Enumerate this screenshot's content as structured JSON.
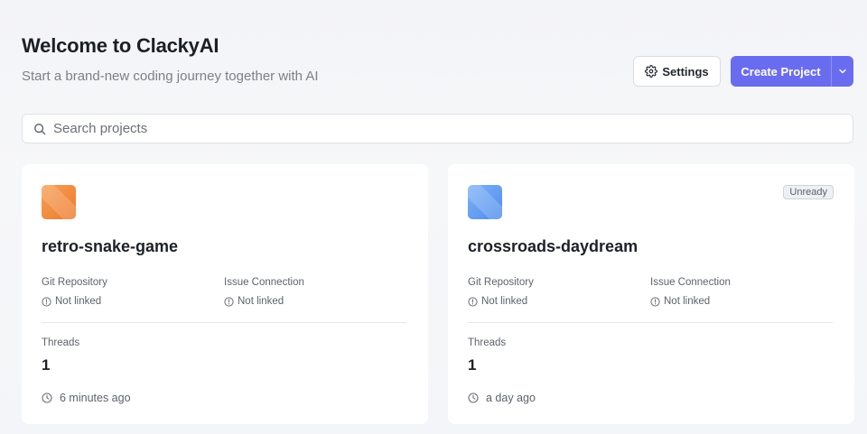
{
  "header": {
    "title": "Welcome to ClackyAI",
    "subtitle": "Start a brand-new coding journey together with AI",
    "settings_label": "Settings",
    "create_label": "Create Project"
  },
  "search": {
    "placeholder": "Search projects",
    "value": ""
  },
  "colors": {
    "accent": "#6a6cf0",
    "orange_icon": "#f28a3c",
    "blue_icon": "#5f9cf2"
  },
  "projects": [
    {
      "name": "retro-snake-game",
      "icon": "orange-project-icon",
      "badge": "",
      "git_label": "Git Repository",
      "git_value": "Not linked",
      "issue_label": "Issue Connection",
      "issue_value": "Not linked",
      "threads_label": "Threads",
      "threads_count": "1",
      "updated": "6 minutes ago"
    },
    {
      "name": "crossroads-daydream",
      "icon": "blue-project-icon",
      "badge": "Unready",
      "git_label": "Git Repository",
      "git_value": "Not linked",
      "issue_label": "Issue Connection",
      "issue_value": "Not linked",
      "threads_label": "Threads",
      "threads_count": "1",
      "updated": "a day ago"
    }
  ]
}
